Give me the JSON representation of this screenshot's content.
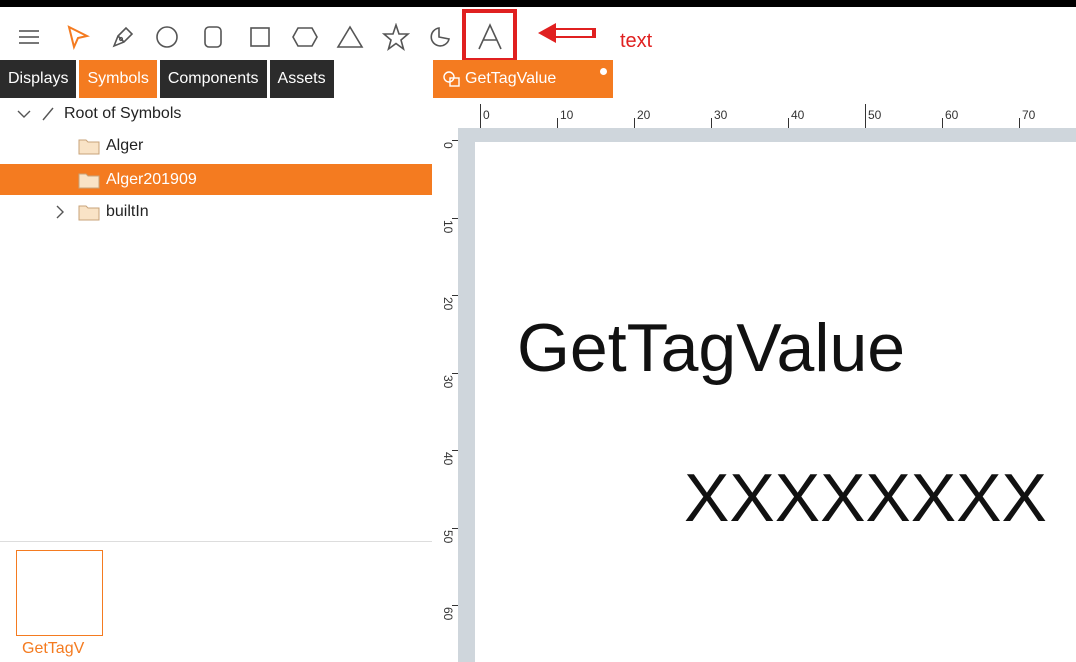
{
  "toolbar": {
    "tools": [
      "menu-icon",
      "pointer-icon",
      "pen-icon",
      "circle-icon",
      "rounded-rect-icon",
      "rect-icon",
      "hexagon-icon",
      "triangle-icon",
      "star-icon",
      "arc-icon",
      "text-tool-icon"
    ],
    "annotation": "text"
  },
  "panel_tabs": {
    "displays": "Displays",
    "symbols": "Symbols",
    "components": "Components",
    "assets": "Assets"
  },
  "tree": {
    "root": "Root of Symbols",
    "items": [
      {
        "label": "Alger",
        "selected": false
      },
      {
        "label": "Alger201909",
        "selected": true
      },
      {
        "label": "builtIn",
        "selected": false
      }
    ]
  },
  "thumbnail": {
    "label": "GetTagV"
  },
  "document_tab": {
    "title": "GetTagValue"
  },
  "ruler": {
    "horizontal": [
      "0",
      "10",
      "20",
      "30",
      "40",
      "50",
      "60",
      "70"
    ],
    "vertical": [
      "0",
      "10",
      "20",
      "30",
      "40",
      "50",
      "60"
    ]
  },
  "canvas": {
    "line1": "GetTagValue",
    "line2": "XXXXXXXX"
  },
  "colors": {
    "accent": "#f47b20",
    "annotation": "#e02020",
    "tab_dark": "#2b2b2b"
  }
}
